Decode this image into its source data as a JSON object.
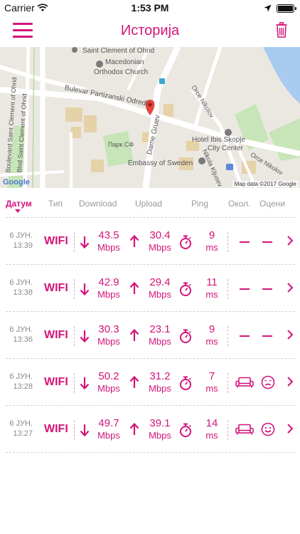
{
  "status": {
    "carrier": "Carrier",
    "time": "1:53 PM"
  },
  "nav": {
    "title": "Историја"
  },
  "map": {
    "labels": {
      "clement": "Saint Clement of Ohrid",
      "macedonian": "Macedonian",
      "orthodox": "Orthodox Church",
      "bulevar": "Bulevar Partizanski Odredi",
      "boulevard_v1": "Boulevard Saint Clement of Ohrid",
      "boulevard_v2": "Blvd Saint Clement of Ohrid",
      "park": "Парк СФ",
      "dame": "Dame Gruev",
      "orce1": "Orce Nikolov",
      "orce2": "Orce Nikolov",
      "hotel1": "Hotel Ibis Skopje",
      "hotel2": "City Center",
      "embassy": "Embassy of Sweden",
      "nikola": "Nikola Kljusev",
      "google": "Google",
      "mapdata": "Map data ©2017 Google"
    }
  },
  "header": {
    "date": "Датум",
    "type": "Тип",
    "download": "Download",
    "upload": "Upload",
    "ping": "Ping",
    "env": "Окол.",
    "rate": "Оцени"
  },
  "rows": [
    {
      "day": "6 ЈУН.",
      "time": "13:39",
      "type": "WIFI",
      "down": "43.5",
      "down_unit": "Mbps",
      "up": "30.4",
      "up_unit": "Mbps",
      "ping": "9",
      "ping_unit": "ms",
      "env": "none",
      "mood": "none"
    },
    {
      "day": "6 ЈУН.",
      "time": "13:38",
      "type": "WIFI",
      "down": "42.9",
      "down_unit": "Mbps",
      "up": "29.4",
      "up_unit": "Mbps",
      "ping": "11",
      "ping_unit": "ms",
      "env": "none",
      "mood": "none"
    },
    {
      "day": "6 ЈУН.",
      "time": "13:36",
      "type": "WIFI",
      "down": "30.3",
      "down_unit": "Mbps",
      "up": "23.1",
      "up_unit": "Mbps",
      "ping": "9",
      "ping_unit": "ms",
      "env": "none",
      "mood": "none"
    },
    {
      "day": "6 ЈУН.",
      "time": "13:28",
      "type": "WIFI",
      "down": "50.2",
      "down_unit": "Mbps",
      "up": "31.2",
      "up_unit": "Mbps",
      "ping": "7",
      "ping_unit": "ms",
      "env": "sofa",
      "mood": "sad"
    },
    {
      "day": "6 ЈУН.",
      "time": "13:27",
      "type": "WIFI",
      "down": "49.7",
      "down_unit": "Mbps",
      "up": "39.1",
      "up_unit": "Mbps",
      "ping": "14",
      "ping_unit": "ms",
      "env": "sofa",
      "mood": "happy"
    }
  ],
  "colors": {
    "accent": "#d4147a"
  }
}
